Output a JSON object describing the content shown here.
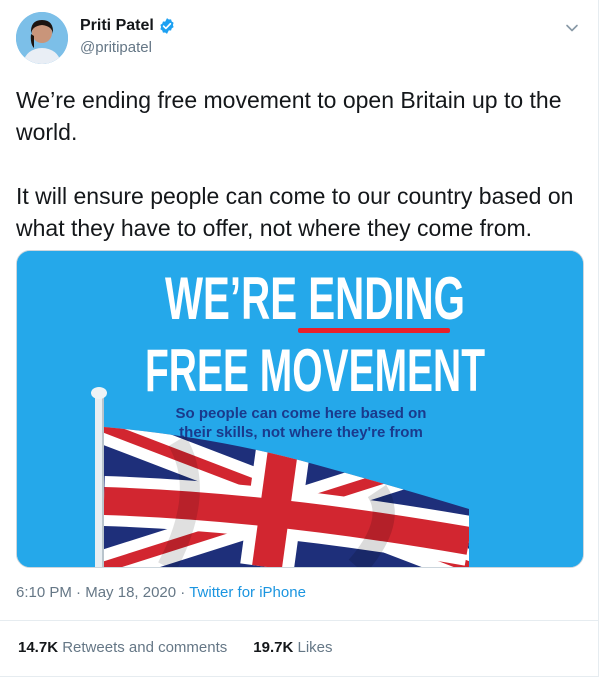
{
  "user": {
    "display_name": "Priti Patel",
    "handle": "@pritipatel",
    "verified": true,
    "avatar_icon": "profile-photo"
  },
  "tweet": {
    "text": "We’re ending free movement to open Britain up to the world.\n\nIt will ensure people can come to our country based on what they have to offer, not where they come from."
  },
  "media": {
    "headline_part1": "WE’RE ",
    "headline_highlight": "ENDING",
    "headline_line2": "FREE MOVEMENT",
    "subtext_line1": "So people can come here based on",
    "subtext_line2": "their skills, not where they're from",
    "image_subject": "union-jack-flag",
    "colors": {
      "background": "#25a8ea",
      "underline": "#e8202a",
      "subtext": "#1a3a8c"
    }
  },
  "meta": {
    "time": "6:10 PM",
    "separator": "·",
    "date": "May 18, 2020",
    "source": "Twitter for iPhone"
  },
  "stats": {
    "retweets_count": "14.7K",
    "retweets_label": "Retweets and comments",
    "likes_count": "19.7K",
    "likes_label": "Likes"
  }
}
